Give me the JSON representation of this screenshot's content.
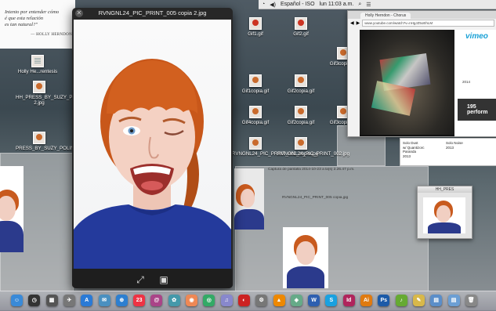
{
  "menubar": {
    "items": [
      "Español - ISO",
      "lun 11:03 a.m."
    ]
  },
  "doc": {
    "quote_lines": [
      "Intento por entender cómo",
      "é que esta relación",
      "es tan natural?\""
    ],
    "author": "— HOLLY HERNDON"
  },
  "desktop_icons": [
    {
      "label": "Holly He...rentesis"
    },
    {
      "label": "HH_PRESS_BY_SUZY_POLING...ido 2.jpg"
    },
    {
      "label": "PRESS_BY_SUZY_POLING_2.jpg"
    },
    {
      "label": "Gif1.gif"
    },
    {
      "label": "Gif2.gif"
    },
    {
      "label": "Gif1copia.gif"
    },
    {
      "label": "Gif2copia.gif"
    },
    {
      "label": "Gif3copia.gif"
    },
    {
      "label": "Gif3copia.gif"
    },
    {
      "label": "Gif2copia.gif"
    },
    {
      "label": "Gif4copia.gif"
    },
    {
      "label": "Gif2copia.gif"
    },
    {
      "label": "Gif3copia.gif"
    },
    {
      "label": "RVNGNL24_PIC_PRINT_002_copia.jpg"
    },
    {
      "label": "RVNGNL24_PIC_PRINT_002.jpg"
    }
  ],
  "quicklook": {
    "title": "RVNGNL24_PIC_PRINT_005 copia 2.jpg",
    "close_glyph": "✕",
    "fullscreen_glyph": "⤢",
    "iphoto_glyph": "▣"
  },
  "browser": {
    "tab": "Holly Herndon - Chorus",
    "url": "www.youtube.com/watch?v=nHgJZ5oEhLM",
    "vimeo_logo": "vimeo",
    "vimeo_perf": "195 perform",
    "aside": [
      "2014"
    ]
  },
  "credits": {
    "col1": [
      "Solo Dust",
      "w/ Quantizorc",
      "Paranda",
      "2013"
    ],
    "col2": [
      "Solo Noise",
      "2013"
    ]
  },
  "hhwin": {
    "title": "HH_PRES"
  },
  "screenshot_label": "Captura de pantalla 2014-10-23 a la(s) 2.26.47 p.m.",
  "screenshot_label2": "RVNGNL24_PIC_PRINT_005 copia.jpg",
  "dock": {
    "apps": [
      {
        "name": "finder",
        "glyph": "☺",
        "color": "#3a8ad8"
      },
      {
        "name": "dashboard",
        "glyph": "◷",
        "color": "#333"
      },
      {
        "name": "mission-control",
        "glyph": "▦",
        "color": "#555"
      },
      {
        "name": "launchpad",
        "glyph": "✈",
        "color": "#777"
      },
      {
        "name": "app-store",
        "glyph": "A",
        "color": "#2a7ad6"
      },
      {
        "name": "mail",
        "glyph": "✉",
        "color": "#4a90c0"
      },
      {
        "name": "safari",
        "glyph": "⊕",
        "color": "#2d7fd0"
      },
      {
        "name": "calendar",
        "glyph": "23",
        "color": "#e34"
      },
      {
        "name": "contacts",
        "glyph": "@",
        "color": "#a48"
      },
      {
        "name": "iphoto",
        "glyph": "✿",
        "color": "#49a"
      },
      {
        "name": "firefox",
        "glyph": "◉",
        "color": "#e85"
      },
      {
        "name": "chrome",
        "glyph": "◎",
        "color": "#3a6"
      },
      {
        "name": "itunes",
        "glyph": "♫",
        "color": "#88c"
      },
      {
        "name": "photo-booth",
        "glyph": "◐",
        "color": "#c22"
      },
      {
        "name": "system-prefs",
        "glyph": "⚙",
        "color": "#777"
      },
      {
        "name": "vlc",
        "glyph": "▲",
        "color": "#e80"
      },
      {
        "name": "preview",
        "glyph": "◈",
        "color": "#6a8"
      },
      {
        "name": "word",
        "glyph": "W",
        "color": "#2e5fb0"
      },
      {
        "name": "skype",
        "glyph": "S",
        "color": "#1aa1e0"
      },
      {
        "name": "indesign",
        "glyph": "Id",
        "color": "#b0245c"
      },
      {
        "name": "illustrator",
        "glyph": "Ai",
        "color": "#e07a10"
      },
      {
        "name": "photoshop",
        "glyph": "Ps",
        "color": "#1c5aa8"
      },
      {
        "name": "spotify",
        "glyph": "♪",
        "color": "#6a3"
      },
      {
        "name": "notes",
        "glyph": "✎",
        "color": "#d8b84a"
      },
      {
        "name": "folder-applications",
        "glyph": "▤",
        "color": "#5b8ec9"
      },
      {
        "name": "folder-documents",
        "glyph": "▤",
        "color": "#6c9fd4"
      },
      {
        "name": "trash",
        "glyph": "🗑",
        "color": "#888"
      }
    ]
  }
}
